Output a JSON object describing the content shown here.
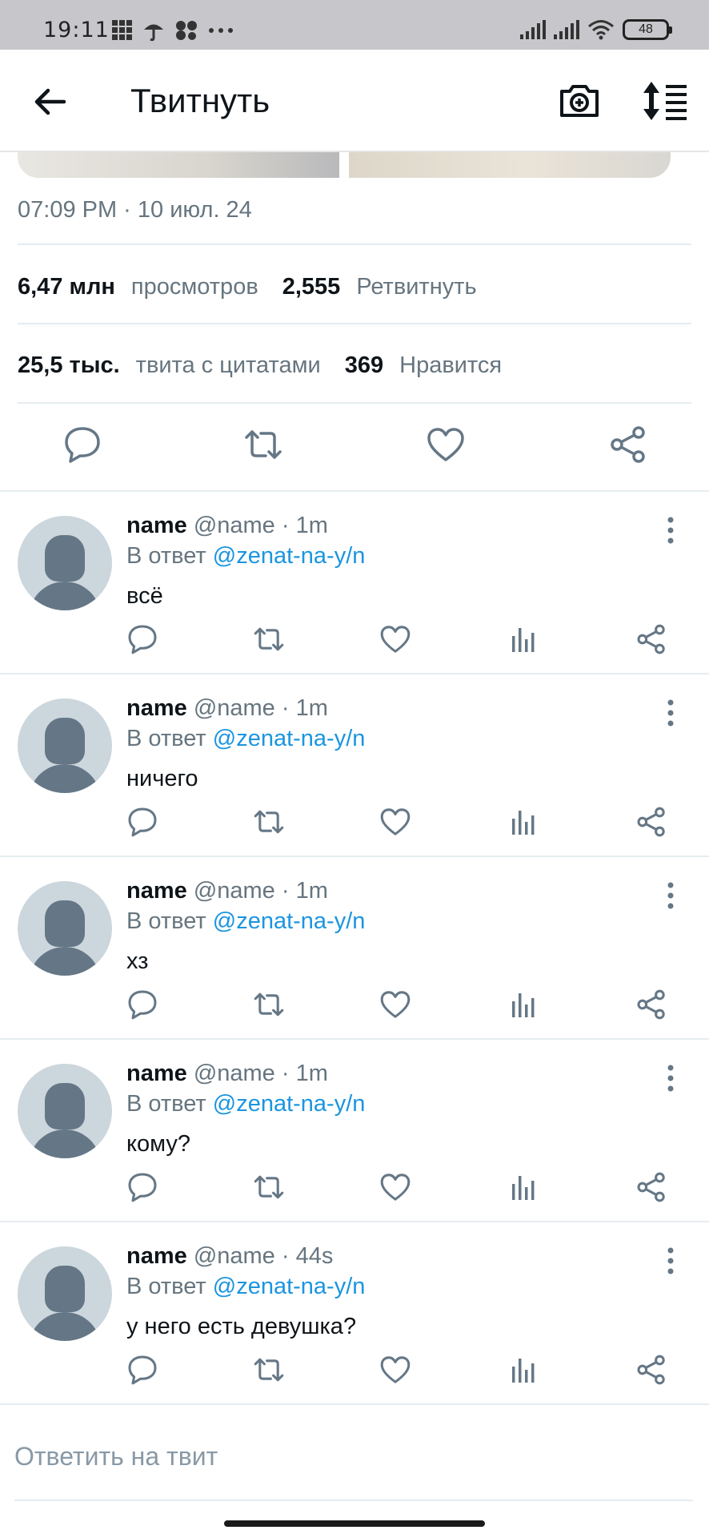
{
  "status_bar": {
    "time": "19:11",
    "battery": "48"
  },
  "header": {
    "title": "Твитнуть"
  },
  "tweet": {
    "timestamp": "07:09 PM · 10 июл. 24",
    "stats": {
      "views_count": "6,47 млн",
      "views_label": "просмотров",
      "retweets_count": "2,555",
      "retweets_label": "Ретвитнуть",
      "quotes_count": "25,5 тыс.",
      "quotes_label": "твита с цитатами",
      "likes_count": "369",
      "likes_label": "Нравится"
    }
  },
  "replies": [
    {
      "name": "name",
      "handle": "@name · 1m",
      "reply_prefix": "В ответ",
      "mention": "@zenat-na-y/n",
      "text": "всё"
    },
    {
      "name": "name",
      "handle": "@name · 1m",
      "reply_prefix": "В ответ",
      "mention": "@zenat-na-y/n",
      "text": "ничего"
    },
    {
      "name": "name",
      "handle": "@name · 1m",
      "reply_prefix": "В ответ",
      "mention": "@zenat-na-y/n",
      "text": "хз"
    },
    {
      "name": "name",
      "handle": "@name · 1m",
      "reply_prefix": "В ответ",
      "mention": "@zenat-na-y/n",
      "text": "кому?"
    },
    {
      "name": "name",
      "handle": "@name · 44s",
      "reply_prefix": "В ответ",
      "mention": "@zenat-na-y/n",
      "text": "у него есть девушка?"
    }
  ],
  "composer": {
    "placeholder": "Ответить на твит"
  },
  "colors": {
    "text_primary": "#0f1419",
    "text_secondary": "#66757f",
    "link": "#1b95e0",
    "divider": "#e6ecf0"
  }
}
